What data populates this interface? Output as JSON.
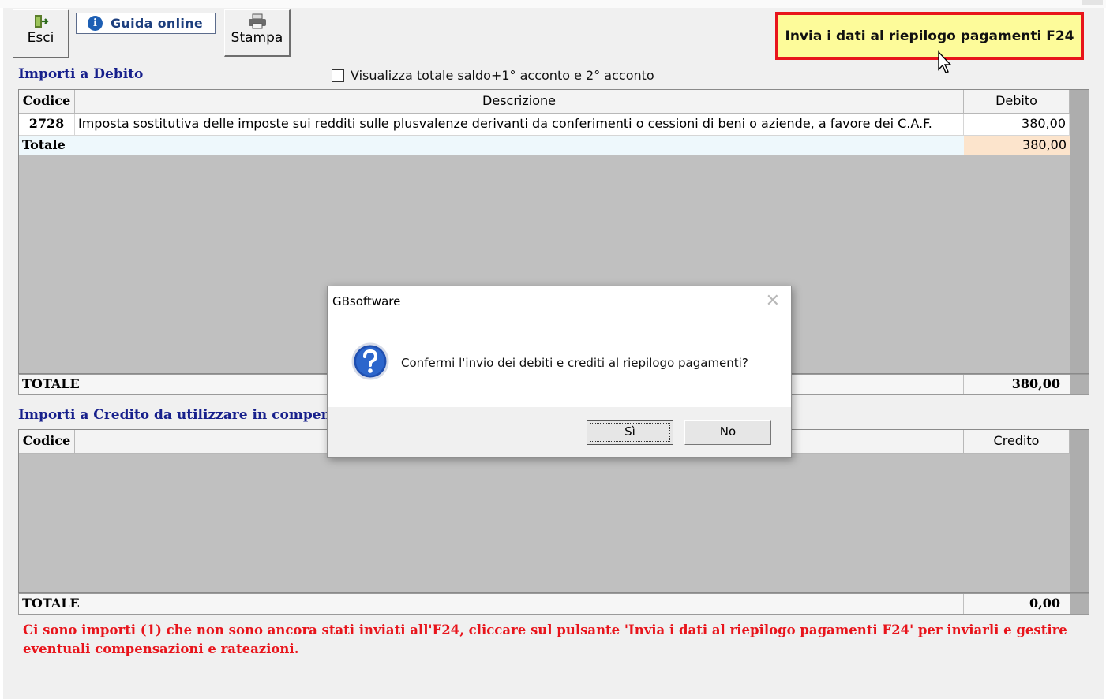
{
  "toolbar": {
    "esci_label": "Esci",
    "guida_label": "Guida online",
    "stampa_label": "Stampa",
    "invia_label": "Invia i dati al riepilogo pagamenti F24"
  },
  "debito": {
    "title": "Importi a Debito",
    "checkbox_label": "Visualizza totale saldo+1° acconto e 2° acconto",
    "columns": {
      "codice": "Codice",
      "descrizione": "Descrizione",
      "debito": "Debito"
    },
    "rows": [
      {
        "codice": "2728",
        "descrizione": "Imposta sostitutiva delle imposte sui redditi sulle plusvalenze derivanti da conferimenti o cessioni di beni o aziende, a favore dei C.A.F.",
        "debito": "380,00"
      }
    ],
    "subtotal_label": "Totale",
    "subtotal_value": "380,00",
    "total_label": "TOTALE",
    "total_value": "380,00"
  },
  "credito": {
    "title": "Importi a Credito da utilizzare in compens",
    "columns": {
      "codice": "Codice",
      "credito": "Credito"
    },
    "total_label": "TOTALE",
    "total_value": "0,00"
  },
  "warning": "Ci sono importi (1) che non sono ancora stati inviati all'F24, cliccare sul pulsante 'Invia i dati al riepilogo pagamenti F24' per inviarli e gestire eventuali compensazioni e rateazioni.",
  "dialog": {
    "title": "GBsoftware",
    "message": "Confermi l'invio dei debiti e crediti al riepilogo pagamenti?",
    "yes_label": "Sì",
    "no_label": "No"
  },
  "colors": {
    "accent_red": "#e8141b",
    "highlight_yellow": "#fdfb9a",
    "title_blue": "#17208c",
    "grid_gray": "#c0c0c0"
  }
}
